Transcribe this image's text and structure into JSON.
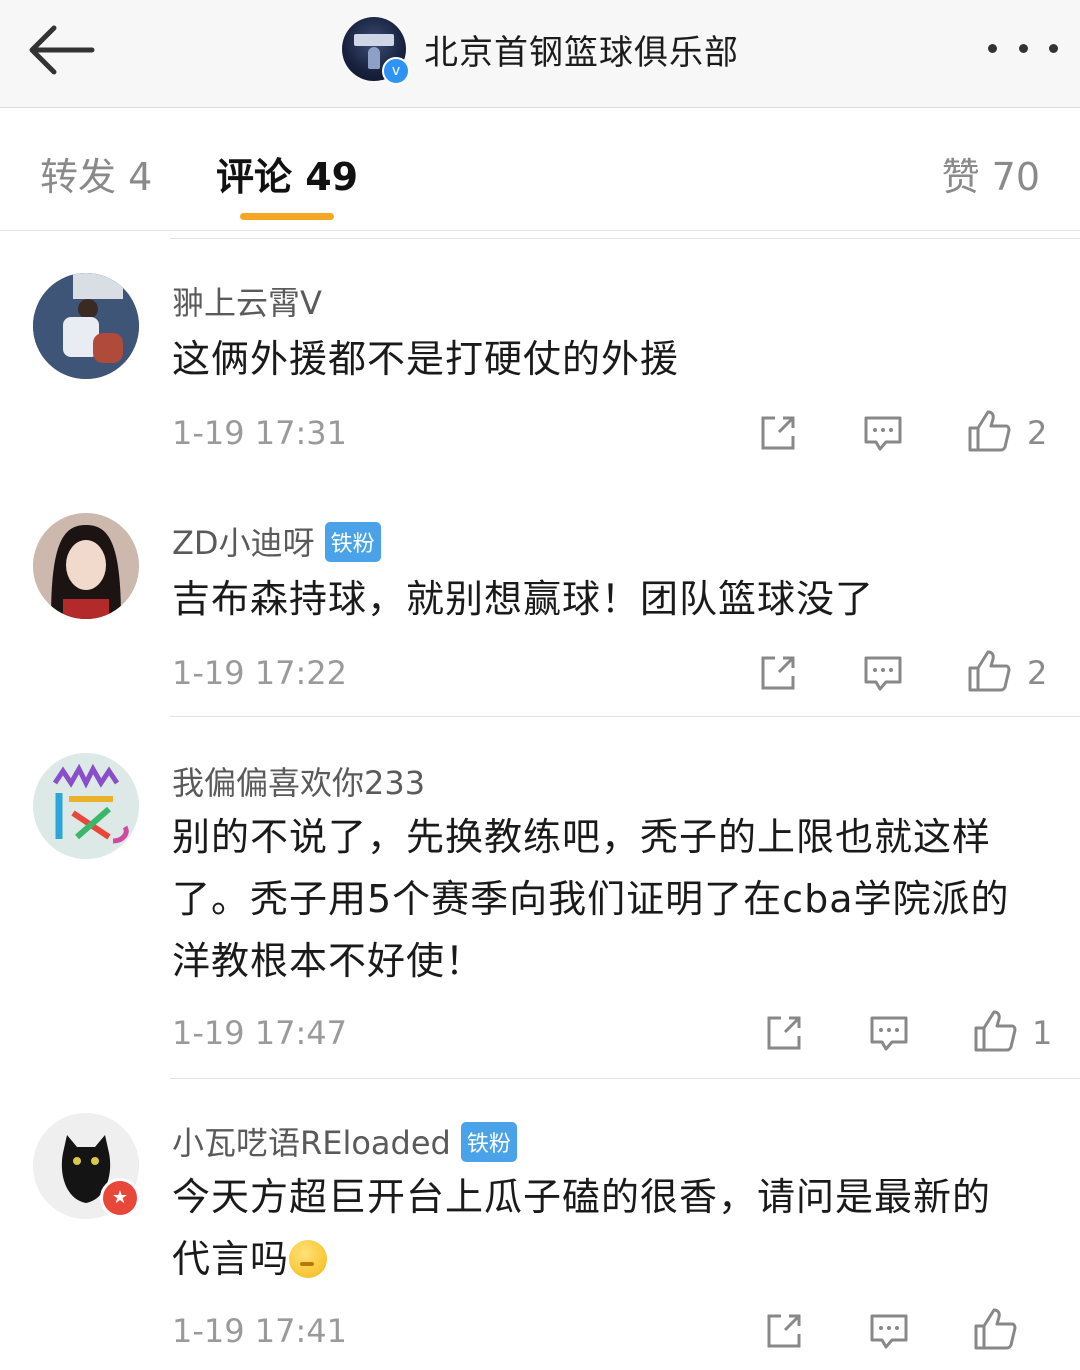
{
  "header": {
    "title": "北京首钢篮球俱乐部",
    "verified_mark": "v",
    "back_icon": "arrow-left-icon",
    "more_icon": "more-dots-icon"
  },
  "tabs": {
    "repost": "转发 4",
    "comment": "评论 49",
    "like": "赞 70",
    "active": "comment",
    "accent": "#f5a623"
  },
  "comments": [
    {
      "username": "翀上云霄V",
      "text": "这俩外援都不是打硬仗的外援",
      "time": "1-19 17:31",
      "likes": "2"
    },
    {
      "username": "ZD小迪呀",
      "badge": "铁粉",
      "text": "吉布森持球，就别想赢球！团队篮球没了",
      "time": "1-19 17:22",
      "likes": "2"
    },
    {
      "username": "我偏偏喜欢你233",
      "text_lines": [
        "别的不说了，先换教练吧，秃子的上限也就这样",
        "了。秃子用5个赛季向我们证明了在cba学院派的",
        "洋教根本不好使！"
      ],
      "time": "1-19 17:47",
      "likes": "1"
    },
    {
      "username": "小瓦呓语REloaded",
      "badge": "铁粉",
      "text_lines": [
        "今天方超巨开台上瓜子磕的很香，请问是最新的",
        "代言吗"
      ],
      "time": "1-19 17:41",
      "likes": ""
    }
  ],
  "colors": {
    "badge": "#4aa3e8",
    "verified": "#2f93f5",
    "avatar_fan_badge": "#e8483a"
  }
}
